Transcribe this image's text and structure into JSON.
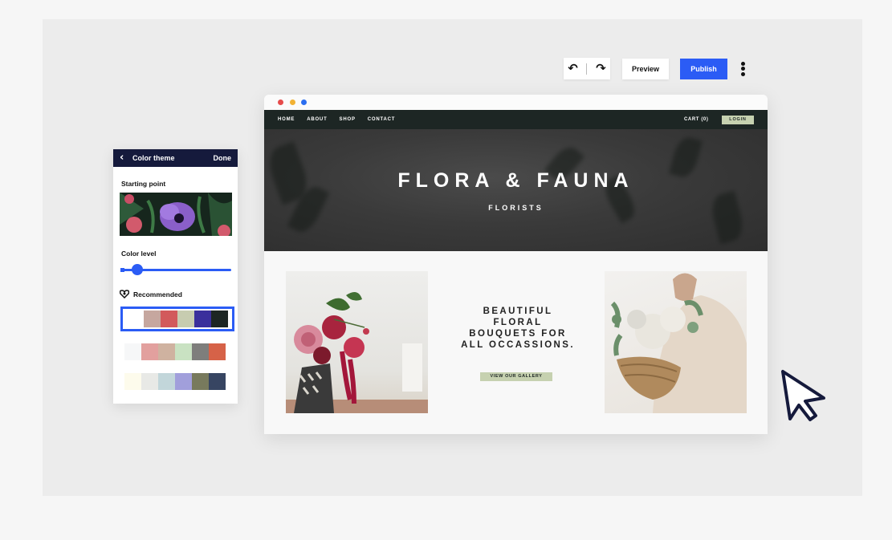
{
  "toolbar": {
    "undo_icon": "undo-icon",
    "redo_icon": "redo-icon",
    "preview_label": "Preview",
    "publish_label": "Publish",
    "publish_color": "#2b5cf5"
  },
  "site": {
    "nav": {
      "links": [
        "HOME",
        "ABOUT",
        "SHOP",
        "CONTACT"
      ],
      "cart": "CART (0)",
      "login": "LOGIN"
    },
    "hero": {
      "title": "FLORA & FAUNA",
      "subtitle": "FLORISTS"
    },
    "tagline": "BEAUTIFUL FLORAL BOUQUETS FOR ALL OCCASSIONS.",
    "gallery_button": "VIEW OUR GALLERY",
    "accent_color": "#c6d1b0",
    "nav_color": "#1d2624"
  },
  "panel": {
    "title": "Color theme",
    "done": "Done",
    "starting_point": "Starting point",
    "color_level": "Color level",
    "color_level_value": 0.05,
    "recommended": "Recommended",
    "palettes": [
      {
        "selected": true,
        "colors": [
          "#ffffff",
          "#c6a79f",
          "#d25a5c",
          "#c7ccb0",
          "#3a2f9c",
          "#1d2624"
        ]
      },
      {
        "selected": false,
        "colors": [
          "#f6f7f8",
          "#e2a09e",
          "#cfb2a0",
          "#c9e2c2",
          "#7e7e7c",
          "#d66248"
        ]
      },
      {
        "selected": false,
        "colors": [
          "#fdfbec",
          "#e8e9e6",
          "#c2d6da",
          "#a19fdb",
          "#787a5d",
          "#374562"
        ]
      }
    ]
  }
}
